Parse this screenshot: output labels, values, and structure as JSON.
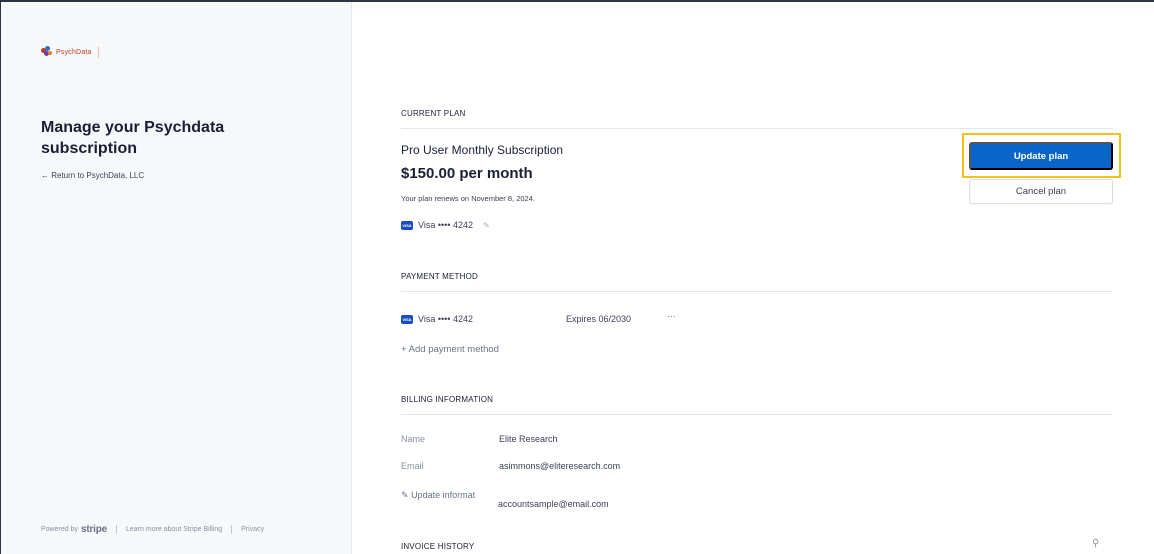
{
  "sidebar": {
    "logo_text": "PsychData",
    "title": "Manage your Psychdata subscription",
    "return_link": "← Return to PsychData, LLC",
    "footer": {
      "powered_by": "Powered by",
      "stripe": "stripe",
      "learn_more": "Learn more about Stripe Billing",
      "privacy": "Privacy"
    }
  },
  "current_plan": {
    "heading": "CURRENT PLAN",
    "plan_name": "Pro User Monthly Subscription",
    "price": "$150.00 per month",
    "renewal": "Your plan renews on November 8, 2024.",
    "card_brand_badge": "VISA",
    "card": "Visa •••• 4242",
    "update_button": "Update plan",
    "cancel_button": "Cancel plan"
  },
  "payment_method": {
    "heading": "PAYMENT METHOD",
    "card_brand_badge": "VISA",
    "card": "Visa •••• 4242",
    "expires": "Expires 06/2030",
    "more": "···",
    "add": "+ Add payment method"
  },
  "billing_information": {
    "heading": "BILLING INFORMATION",
    "name_label": "Name",
    "name_value": "Elite Research",
    "email_label": "Email",
    "email_value": "asimmons@eliteresearch.com",
    "update_link": "Update informat",
    "autofill_email": "accountsample@email.com"
  },
  "invoice_history": {
    "heading": "INVOICE HISTORY"
  },
  "colors": {
    "primary_button": "#0a65c9",
    "highlight": "#f2c21b",
    "sidebar_bg": "#f7f8f9"
  },
  "icons": {
    "edit": "pencil-square-icon",
    "search": "search-icon",
    "card": "visa-card-icon"
  }
}
